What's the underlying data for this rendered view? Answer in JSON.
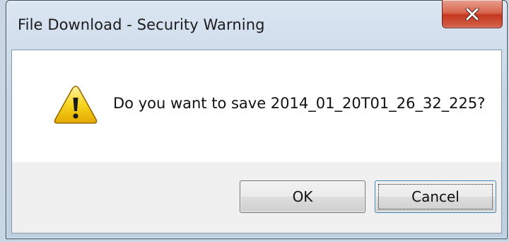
{
  "window": {
    "title": "File Download - Security Warning",
    "close_icon": "close-icon"
  },
  "dialog": {
    "icon": "warning-icon",
    "message": "Do you want to save 2014_01_20T01_26_32_225?"
  },
  "buttons": {
    "ok_label": "OK",
    "cancel_label": "Cancel"
  },
  "colors": {
    "close_button": "#c4371f",
    "warning_fill": "#f7d51e",
    "focus_border": "#3c7fb1"
  }
}
